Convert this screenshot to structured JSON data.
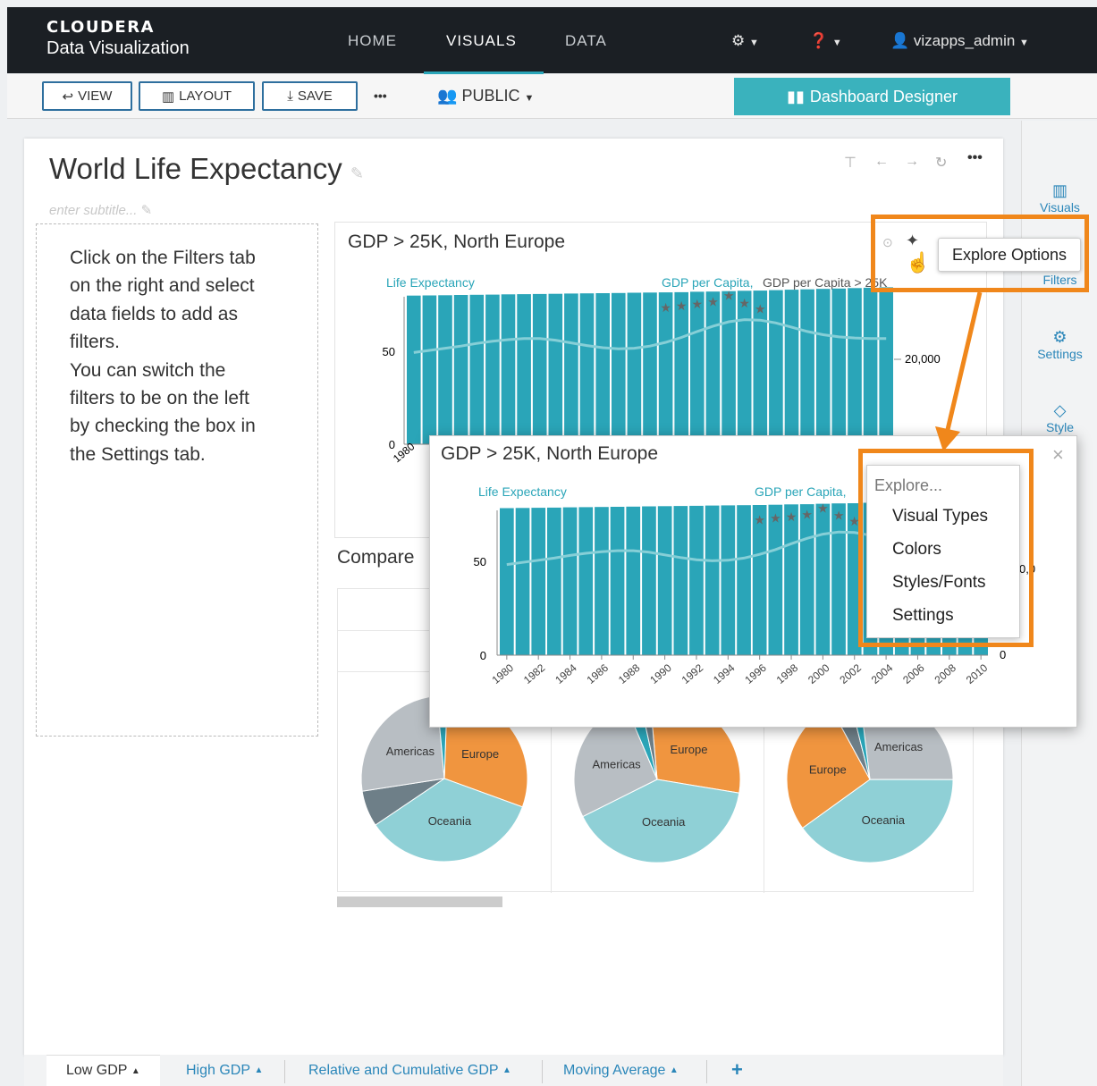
{
  "brand": {
    "line1": "CLOUDERA",
    "line2": "Data Visualization"
  },
  "nav": {
    "home": "HOME",
    "visuals": "VISUALS",
    "data": "DATA"
  },
  "user": {
    "name": "vizapps_admin"
  },
  "toolbar": {
    "view": "VIEW",
    "layout": "LAYOUT",
    "save": "SAVE",
    "more": "•••",
    "public": "PUBLIC",
    "designer": "Dashboard Designer"
  },
  "sidebar": {
    "visuals": "Visuals",
    "filters": "Filters",
    "settings": "Settings",
    "style": "Style"
  },
  "dashboard": {
    "title": "World Life Expectancy",
    "subtitle_placeholder": "enter subtitle...",
    "filter_help": "Click on the Filters tab\non the right and select\ndata fields to add as\nfilters.\nYou can switch the\nfilters to be on the left\nby checking the box in\nthe Settings tab."
  },
  "card1": {
    "title": "GDP > 25K, North Europe",
    "legend_left": "Life Expectancy",
    "legend_right_a": "GDP per Capita,",
    "legend_right_b": "GDP per Capita > 25K",
    "y_ticks": [
      "0",
      "50"
    ],
    "y2_ticks": [
      "20,000"
    ]
  },
  "card2": {
    "title": "Compare"
  },
  "tooltip": {
    "text": "Explore Options"
  },
  "popup": {
    "title": "GDP > 25K, North Europe",
    "legend_left": "Life Expectancy",
    "legend_right_a": "GDP per Capita,",
    "close": "×",
    "y2_partial": "0,0",
    "y2_zero": "0"
  },
  "explore_menu": {
    "header": "Explore...",
    "items": [
      "Visual Types",
      "Colors",
      "Styles/Fonts",
      "Settings"
    ]
  },
  "pies": [
    {
      "slices": [
        {
          "label": "Europe",
          "value": 30,
          "color": "#f0953f"
        },
        {
          "label": "Oceania",
          "value": 35,
          "color": "#8fd0d6"
        },
        {
          "label": "",
          "value": 7,
          "color": "#6e7f88"
        },
        {
          "label": "Americas",
          "value": 26,
          "color": "#b8bec3"
        },
        {
          "label": "",
          "value": 2,
          "color": "#2aa5b8"
        }
      ]
    },
    {
      "slices": [
        {
          "label": "Europe",
          "value": 29,
          "color": "#f0953f"
        },
        {
          "label": "Oceania",
          "value": 40,
          "color": "#8fd0d6"
        },
        {
          "label": "Americas",
          "value": 26,
          "color": "#b8bec3"
        },
        {
          "label": "",
          "value": 3,
          "color": "#2aa5b8"
        },
        {
          "label": "",
          "value": 2,
          "color": "#6e7f88"
        }
      ]
    },
    {
      "slices": [
        {
          "label": "Americas",
          "value": 27,
          "color": "#b8bec3"
        },
        {
          "label": "Oceania",
          "value": 40,
          "color": "#8fd0d6"
        },
        {
          "label": "Europe",
          "value": 27,
          "color": "#f0953f"
        },
        {
          "label": "",
          "value": 4,
          "color": "#6e7f88"
        },
        {
          "label": "",
          "value": 2,
          "color": "#2aa5b8"
        }
      ]
    }
  ],
  "chart_data": {
    "type": "bar",
    "title": "GDP > 25K, North Europe",
    "categories": [
      "1980",
      "1981",
      "1982",
      "1983",
      "1984",
      "1985",
      "1986",
      "1987",
      "1988",
      "1989",
      "1990",
      "1991",
      "1992",
      "1993",
      "1994",
      "1995",
      "1996",
      "1997",
      "1998",
      "1999",
      "2000",
      "2001",
      "2002",
      "2003",
      "2004",
      "2005",
      "2006",
      "2007",
      "2008",
      "2009",
      "2010"
    ],
    "x_tick_labels": [
      "1980",
      "1982",
      "1984",
      "1986",
      "1988",
      "1990",
      "1992",
      "1994",
      "1996",
      "1998",
      "2000",
      "2002",
      "2004",
      "2006",
      "2008",
      "2010"
    ],
    "series": [
      {
        "name": "Life Expectancy",
        "values": [
          73.5,
          73.6,
          73.7,
          73.8,
          73.9,
          74.0,
          74.1,
          74.2,
          74.3,
          74.4,
          74.5,
          74.6,
          74.7,
          74.8,
          74.9,
          75.0,
          75.1,
          75.2,
          75.4,
          75.5,
          75.7,
          75.9,
          76.0,
          76.2,
          76.4,
          76.6,
          76.8,
          77.0,
          77.2,
          77.4,
          77.6
        ]
      },
      {
        "name": "GDP per Capita",
        "values": [
          17000,
          17400,
          17800,
          18200,
          18700,
          19100,
          19400,
          19600,
          19600,
          19300,
          18800,
          18300,
          17900,
          17700,
          17800,
          18200,
          18900,
          19800,
          20900,
          21900,
          22700,
          23100,
          23000,
          22500,
          21700,
          20900,
          20300,
          19900,
          19700,
          19600,
          19600
        ]
      },
      {
        "name": "GDP per Capita > 25K",
        "values": [
          null,
          null,
          null,
          null,
          null,
          null,
          null,
          null,
          null,
          null,
          null,
          null,
          null,
          null,
          null,
          null,
          25400,
          25700,
          26000,
          26400,
          27600,
          26200,
          25100,
          null,
          null,
          null,
          null,
          null,
          null,
          null,
          null
        ]
      }
    ],
    "ylim": [
      0,
      80
    ],
    "y2lim": [
      0,
      30000
    ]
  },
  "page_tabs": [
    "Low GDP",
    "High GDP",
    "Relative and Cumulative GDP",
    "Moving Average"
  ],
  "colors": {
    "bar": "#2aa5b8",
    "accent": "#3ab2bd",
    "callout": "#f0871b",
    "link": "#2a86b9"
  }
}
